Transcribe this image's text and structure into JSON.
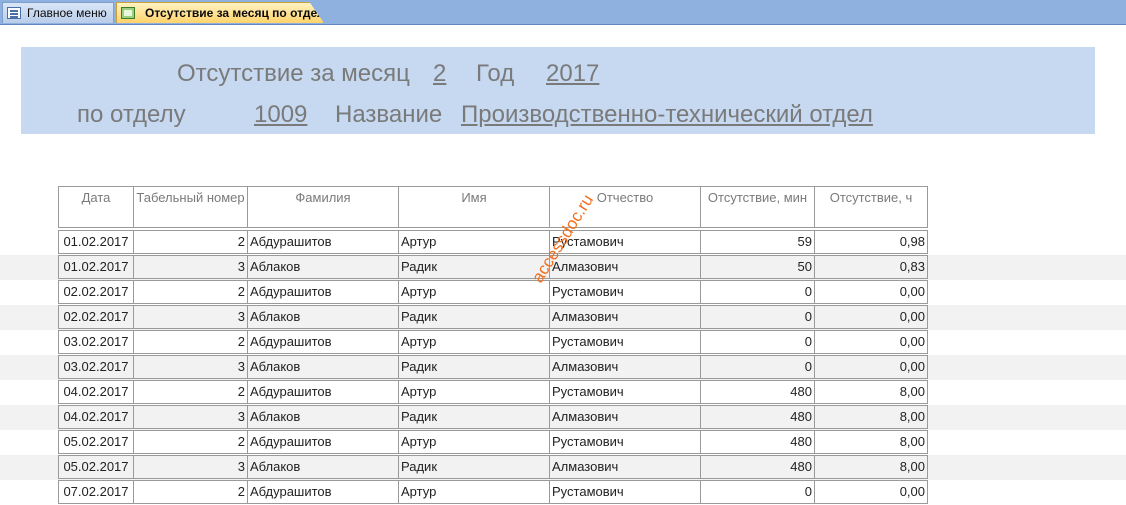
{
  "tabs": [
    {
      "label": "Главное меню",
      "icon": "form-icon"
    },
    {
      "label": "Отсутствие за месяц по отделу",
      "icon": "report-icon"
    }
  ],
  "header": {
    "title": "Отсутствие за месяц",
    "month": "2",
    "year_label": "Год",
    "year": "2017",
    "dept_label": "по отделу",
    "dept_code": "1009",
    "name_label": "Название",
    "dept_name": "Производственно-технический отдел"
  },
  "table": {
    "columns": [
      "Дата",
      "Табельный номер",
      "Фамилия",
      "Имя",
      "Отчество",
      "Отсутствие, мин",
      "Отсутствие, ч"
    ],
    "rows": [
      [
        "01.02.2017",
        "2",
        "Абдурашитов",
        "Артур",
        "Рустамович",
        "59",
        "0,98"
      ],
      [
        "01.02.2017",
        "3",
        "Аблаков",
        "Радик",
        "Алмазович",
        "50",
        "0,83"
      ],
      [
        "02.02.2017",
        "2",
        "Абдурашитов",
        "Артур",
        "Рустамович",
        "0",
        "0,00"
      ],
      [
        "02.02.2017",
        "3",
        "Аблаков",
        "Радик",
        "Алмазович",
        "0",
        "0,00"
      ],
      [
        "03.02.2017",
        "2",
        "Абдурашитов",
        "Артур",
        "Рустамович",
        "0",
        "0,00"
      ],
      [
        "03.02.2017",
        "3",
        "Аблаков",
        "Радик",
        "Алмазович",
        "0",
        "0,00"
      ],
      [
        "04.02.2017",
        "2",
        "Абдурашитов",
        "Артур",
        "Рустамович",
        "480",
        "8,00"
      ],
      [
        "04.02.2017",
        "3",
        "Аблаков",
        "Радик",
        "Алмазович",
        "480",
        "8,00"
      ],
      [
        "05.02.2017",
        "2",
        "Абдурашитов",
        "Артур",
        "Рустамович",
        "480",
        "8,00"
      ],
      [
        "05.02.2017",
        "3",
        "Аблаков",
        "Радик",
        "Алмазович",
        "480",
        "8,00"
      ],
      [
        "07.02.2017",
        "2",
        "Абдурашитов",
        "Артур",
        "Рустамович",
        "0",
        "0,00"
      ]
    ]
  },
  "watermark": "accessdoc.ru",
  "colors": {
    "band": "#c6d9f1",
    "active_tab": "#ffd36b",
    "tab_strip": "#8fb1e0",
    "watermark": "#f07020",
    "row_alt": "#f2f2f2"
  }
}
